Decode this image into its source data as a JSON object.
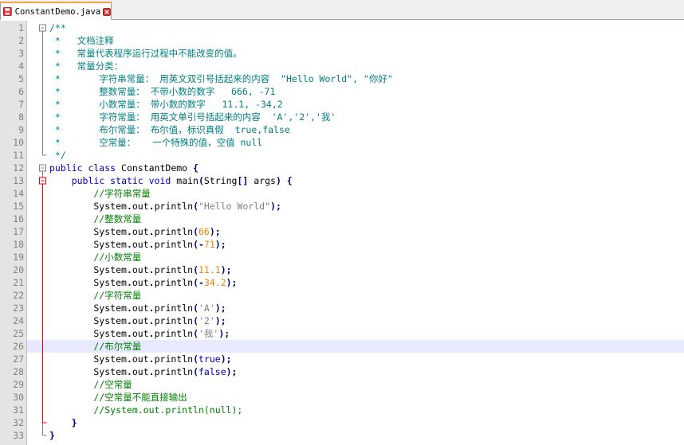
{
  "tab": {
    "filename": "ConstantDemo.java"
  },
  "colors": {
    "comment": "#008080",
    "linecomment": "#008000",
    "keyword": "#0000c0",
    "number": "#ff8000",
    "string": "#808080",
    "operator": "#000080",
    "fold_line": "#e00000",
    "current_line": "#e8e8ff",
    "tab_accent": "#f7a14a"
  },
  "editor": {
    "current_line": 26,
    "lines": [
      {
        "n": "1",
        "tokens": [
          [
            "c",
            "/**"
          ]
        ],
        "fold": "start"
      },
      {
        "n": "2",
        "tokens": [
          [
            "c",
            " *   文档注释"
          ]
        ]
      },
      {
        "n": "3",
        "tokens": [
          [
            "c",
            " *   常量代表程序运行过程中不能改变的值。"
          ]
        ]
      },
      {
        "n": "4",
        "tokens": [
          [
            "c",
            " *   常量分类："
          ]
        ]
      },
      {
        "n": "5",
        "tokens": [
          [
            "c",
            " *       字符串常量： 用英文双引号括起来的内容  \"Hello World\", \"你好\""
          ]
        ]
      },
      {
        "n": "6",
        "tokens": [
          [
            "c",
            " *       整数常量： 不带小数的数字   666, -71"
          ]
        ]
      },
      {
        "n": "7",
        "tokens": [
          [
            "c",
            " *       小数常量： 带小数的数字   11.1, -34,2"
          ]
        ]
      },
      {
        "n": "8",
        "tokens": [
          [
            "c",
            " *       字符常量： 用英文单引号括起来的内容  'A','2','我'"
          ]
        ]
      },
      {
        "n": "9",
        "tokens": [
          [
            "c",
            " *       布尔常量： 布尔值，标识真假  true,false"
          ]
        ]
      },
      {
        "n": "10",
        "tokens": [
          [
            "c",
            " *       空常量：   一个特殊的值，空值 null"
          ]
        ]
      },
      {
        "n": "11",
        "tokens": [
          [
            "c",
            " */"
          ]
        ],
        "fold": "end"
      },
      {
        "n": "12",
        "tokens": [
          [
            "k",
            "public class "
          ],
          [
            "t",
            "ConstantDemo "
          ],
          [
            "o",
            "{"
          ]
        ],
        "fold": "start"
      },
      {
        "n": "13",
        "tokens": [
          [
            "t",
            "    "
          ],
          [
            "k",
            "public static void "
          ],
          [
            "t",
            "main"
          ],
          [
            "o",
            "("
          ],
          [
            "t",
            "String"
          ],
          [
            "o",
            "[] "
          ],
          [
            "t",
            "args"
          ],
          [
            "o",
            ") {"
          ]
        ],
        "fold": "start"
      },
      {
        "n": "14",
        "tokens": [
          [
            "t",
            "        "
          ],
          [
            "l",
            "//字符串常量"
          ]
        ]
      },
      {
        "n": "15",
        "tokens": [
          [
            "t",
            "        System"
          ],
          [
            "o",
            "."
          ],
          [
            "t",
            "out"
          ],
          [
            "o",
            "."
          ],
          [
            "t",
            "println"
          ],
          [
            "o",
            "("
          ],
          [
            "s",
            "\"Hello World\""
          ],
          [
            "o",
            ");"
          ]
        ]
      },
      {
        "n": "16",
        "tokens": [
          [
            "t",
            "        "
          ],
          [
            "l",
            "//整数常量"
          ]
        ]
      },
      {
        "n": "17",
        "tokens": [
          [
            "t",
            "        System"
          ],
          [
            "o",
            "."
          ],
          [
            "t",
            "out"
          ],
          [
            "o",
            "."
          ],
          [
            "t",
            "println"
          ],
          [
            "o",
            "("
          ],
          [
            "num",
            "66"
          ],
          [
            "o",
            ");"
          ]
        ]
      },
      {
        "n": "18",
        "tokens": [
          [
            "t",
            "        System"
          ],
          [
            "o",
            "."
          ],
          [
            "t",
            "out"
          ],
          [
            "o",
            "."
          ],
          [
            "t",
            "println"
          ],
          [
            "o",
            "(-"
          ],
          [
            "num",
            "71"
          ],
          [
            "o",
            ");"
          ]
        ]
      },
      {
        "n": "19",
        "tokens": [
          [
            "t",
            "        "
          ],
          [
            "l",
            "//小数常量"
          ]
        ]
      },
      {
        "n": "20",
        "tokens": [
          [
            "t",
            "        System"
          ],
          [
            "o",
            "."
          ],
          [
            "t",
            "out"
          ],
          [
            "o",
            "."
          ],
          [
            "t",
            "println"
          ],
          [
            "o",
            "("
          ],
          [
            "num",
            "11.1"
          ],
          [
            "o",
            ");"
          ]
        ]
      },
      {
        "n": "21",
        "tokens": [
          [
            "t",
            "        System"
          ],
          [
            "o",
            "."
          ],
          [
            "t",
            "out"
          ],
          [
            "o",
            "."
          ],
          [
            "t",
            "println"
          ],
          [
            "o",
            "(-"
          ],
          [
            "num",
            "34.2"
          ],
          [
            "o",
            ");"
          ]
        ]
      },
      {
        "n": "22",
        "tokens": [
          [
            "t",
            "        "
          ],
          [
            "l",
            "//字符常量"
          ]
        ]
      },
      {
        "n": "23",
        "tokens": [
          [
            "t",
            "        System"
          ],
          [
            "o",
            "."
          ],
          [
            "t",
            "out"
          ],
          [
            "o",
            "."
          ],
          [
            "t",
            "println"
          ],
          [
            "o",
            "("
          ],
          [
            "s",
            "'A'"
          ],
          [
            "o",
            ");"
          ]
        ]
      },
      {
        "n": "24",
        "tokens": [
          [
            "t",
            "        System"
          ],
          [
            "o",
            "."
          ],
          [
            "t",
            "out"
          ],
          [
            "o",
            "."
          ],
          [
            "t",
            "println"
          ],
          [
            "o",
            "("
          ],
          [
            "s",
            "'2'"
          ],
          [
            "o",
            ");"
          ]
        ]
      },
      {
        "n": "25",
        "tokens": [
          [
            "t",
            "        System"
          ],
          [
            "o",
            "."
          ],
          [
            "t",
            "out"
          ],
          [
            "o",
            "."
          ],
          [
            "t",
            "println"
          ],
          [
            "o",
            "("
          ],
          [
            "s",
            "'我'"
          ],
          [
            "o",
            ");"
          ]
        ]
      },
      {
        "n": "26",
        "tokens": [
          [
            "t",
            "        "
          ],
          [
            "l",
            "//布尔常量"
          ]
        ]
      },
      {
        "n": "27",
        "tokens": [
          [
            "t",
            "        System"
          ],
          [
            "o",
            "."
          ],
          [
            "t",
            "out"
          ],
          [
            "o",
            "."
          ],
          [
            "t",
            "println"
          ],
          [
            "o",
            "("
          ],
          [
            "k",
            "true"
          ],
          [
            "o",
            ");"
          ]
        ]
      },
      {
        "n": "28",
        "tokens": [
          [
            "t",
            "        System"
          ],
          [
            "o",
            "."
          ],
          [
            "t",
            "out"
          ],
          [
            "o",
            "."
          ],
          [
            "t",
            "println"
          ],
          [
            "o",
            "("
          ],
          [
            "k",
            "false"
          ],
          [
            "o",
            ");"
          ]
        ]
      },
      {
        "n": "29",
        "tokens": [
          [
            "t",
            "        "
          ],
          [
            "l",
            "//空常量"
          ]
        ]
      },
      {
        "n": "30",
        "tokens": [
          [
            "t",
            "        "
          ],
          [
            "l",
            "//空常量不能直接输出"
          ]
        ]
      },
      {
        "n": "31",
        "tokens": [
          [
            "t",
            "        "
          ],
          [
            "l",
            "//System.out.println(null);"
          ]
        ]
      },
      {
        "n": "32",
        "tokens": [
          [
            "t",
            "    "
          ],
          [
            "o",
            "}"
          ]
        ],
        "fold": "end"
      },
      {
        "n": "33",
        "tokens": [
          [
            "o",
            "}"
          ]
        ],
        "fold": "end"
      }
    ]
  }
}
